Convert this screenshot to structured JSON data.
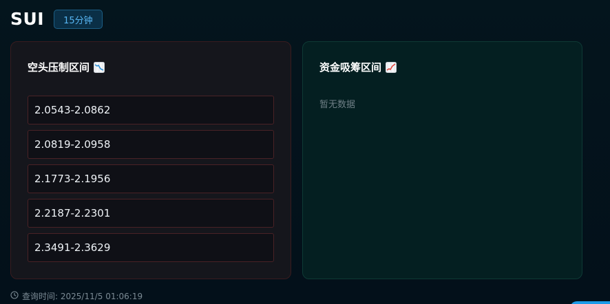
{
  "header": {
    "symbol": "SUI",
    "timeframe_badge": "15分钟"
  },
  "short_pressure": {
    "title": "空头压制区间",
    "icon": "chart-decreasing-icon",
    "accent_color": "#c0392b",
    "ranges": [
      "2.0543-2.0862",
      "2.0819-2.0958",
      "2.1773-2.1956",
      "2.2187-2.2301",
      "2.3491-2.3629"
    ]
  },
  "accumulation": {
    "title": "资金吸筹区间",
    "icon": "chart-increasing-icon",
    "empty_text": "暂无数据"
  },
  "footer": {
    "query_time_label": "查询时间: 2025/11/5 01:06:19",
    "icon": "clock-icon"
  }
}
